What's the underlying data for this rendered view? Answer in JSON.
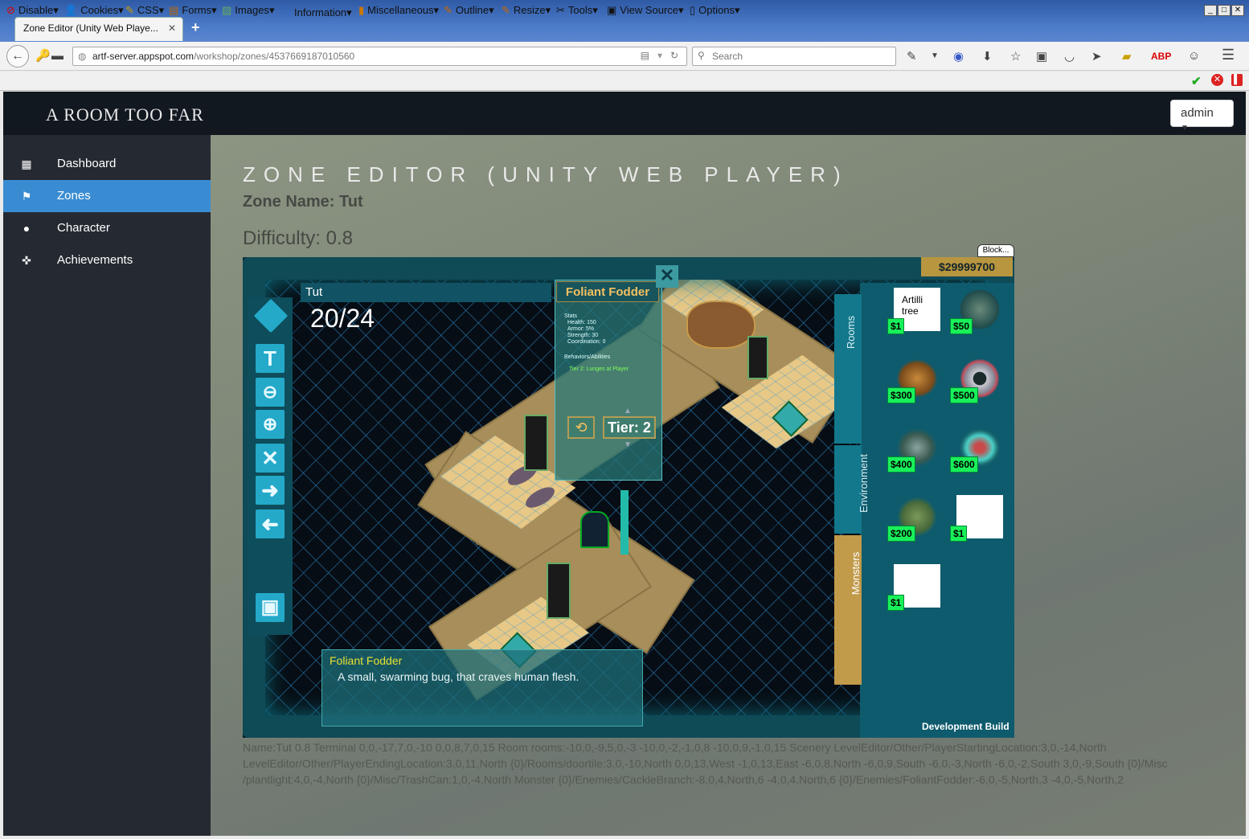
{
  "browser": {
    "tab_title": "Zone Editor (Unity Web Playe...",
    "tab_close": "✕",
    "new_tab": "+",
    "url_host": "artf-server.appspot.com",
    "url_path": "/workshop/zones/4537669187010560",
    "search_placeholder": "Search",
    "window_buttons": [
      "_",
      "□",
      "✕"
    ]
  },
  "devbar": {
    "items": [
      "Disable",
      "Cookies",
      "CSS",
      "Forms",
      "Images",
      "Information",
      "Miscellaneous",
      "Outline",
      "Resize",
      "Tools",
      "View Source",
      "Options"
    ]
  },
  "site": {
    "brand": "A ROOM TOO FAR",
    "user_menu": "admin"
  },
  "sidebar": {
    "items": [
      {
        "label": "Dashboard",
        "icon": "grid-icon",
        "active": false
      },
      {
        "label": "Zones",
        "icon": "flag-icon",
        "active": true
      },
      {
        "label": "Character",
        "icon": "user-icon",
        "active": false
      },
      {
        "label": "Achievements",
        "icon": "crosshair-icon",
        "active": false
      }
    ]
  },
  "page": {
    "title": "ZONE EDITOR (UNITY WEB PLAYER)",
    "zone_name": "Zone Name: Tut",
    "difficulty": "Difficulty: 0.8",
    "block_button": "Block..."
  },
  "game": {
    "zone_label": "Tut",
    "count": "20/24",
    "money": "$29999700",
    "monster_panel": {
      "title": "Foliant Fodder",
      "stats_header": "Stats",
      "stats": [
        "Health: 150",
        "Armor: 5%",
        "Strength: 30",
        "Coordination: 0"
      ],
      "behaviors_header": "Behaviors/Abilities",
      "behavior": "Tier 2: Lunges at Player",
      "tier": "Tier: 2"
    },
    "tabs": [
      "Rooms",
      "Environment",
      "Monsters"
    ],
    "active_tab": "Monsters",
    "shop_items": [
      {
        "name": "Artilli tree",
        "price": "$1"
      },
      {
        "name": "",
        "price": "$50"
      },
      {
        "name": "",
        "price": "$300"
      },
      {
        "name": "",
        "price": "$500"
      },
      {
        "name": "",
        "price": "$400"
      },
      {
        "name": "",
        "price": "$600"
      },
      {
        "name": "",
        "price": "$200"
      },
      {
        "name": "",
        "price": "$1"
      },
      {
        "name": "",
        "price": "$1"
      }
    ],
    "info_title": "Foliant Fodder",
    "info_desc": "A small, swarming bug, that craves human flesh.",
    "build_label": "Development Build"
  },
  "map_data": "Name:Tut 0.8 Terminal 0,0,-17,7,0,-10 0,0,8,7,0,15 Room rooms:-10,0,-9,5,0,-3 -10,0,-2,-1,0,8 -10,0,9,-1,0,15 Scenery LevelEditor/Other/PlayerStartingLocation:3,0,-14,North LevelEditor/Other/PlayerEndingLocation:3,0,11,North {0}/Rooms/doortile:3,0,-10,North 0,0,13,West -1,0,13,East -6,0,8,North -6,0,9,South -6,0,-3,North -6,0,-2,South 3,0,-9,South {0}/Misc /plantlight:4,0,-4,North {0}/Misc/TrashCan:1,0,-4,North Monster {0}/Enemies/CackleBranch:-8,0,4,North,6 -4,0,4,North,6 {0}/Enemies/FoliantFodder:-6,0,-5,North,3 -4,0,-5,North,2"
}
